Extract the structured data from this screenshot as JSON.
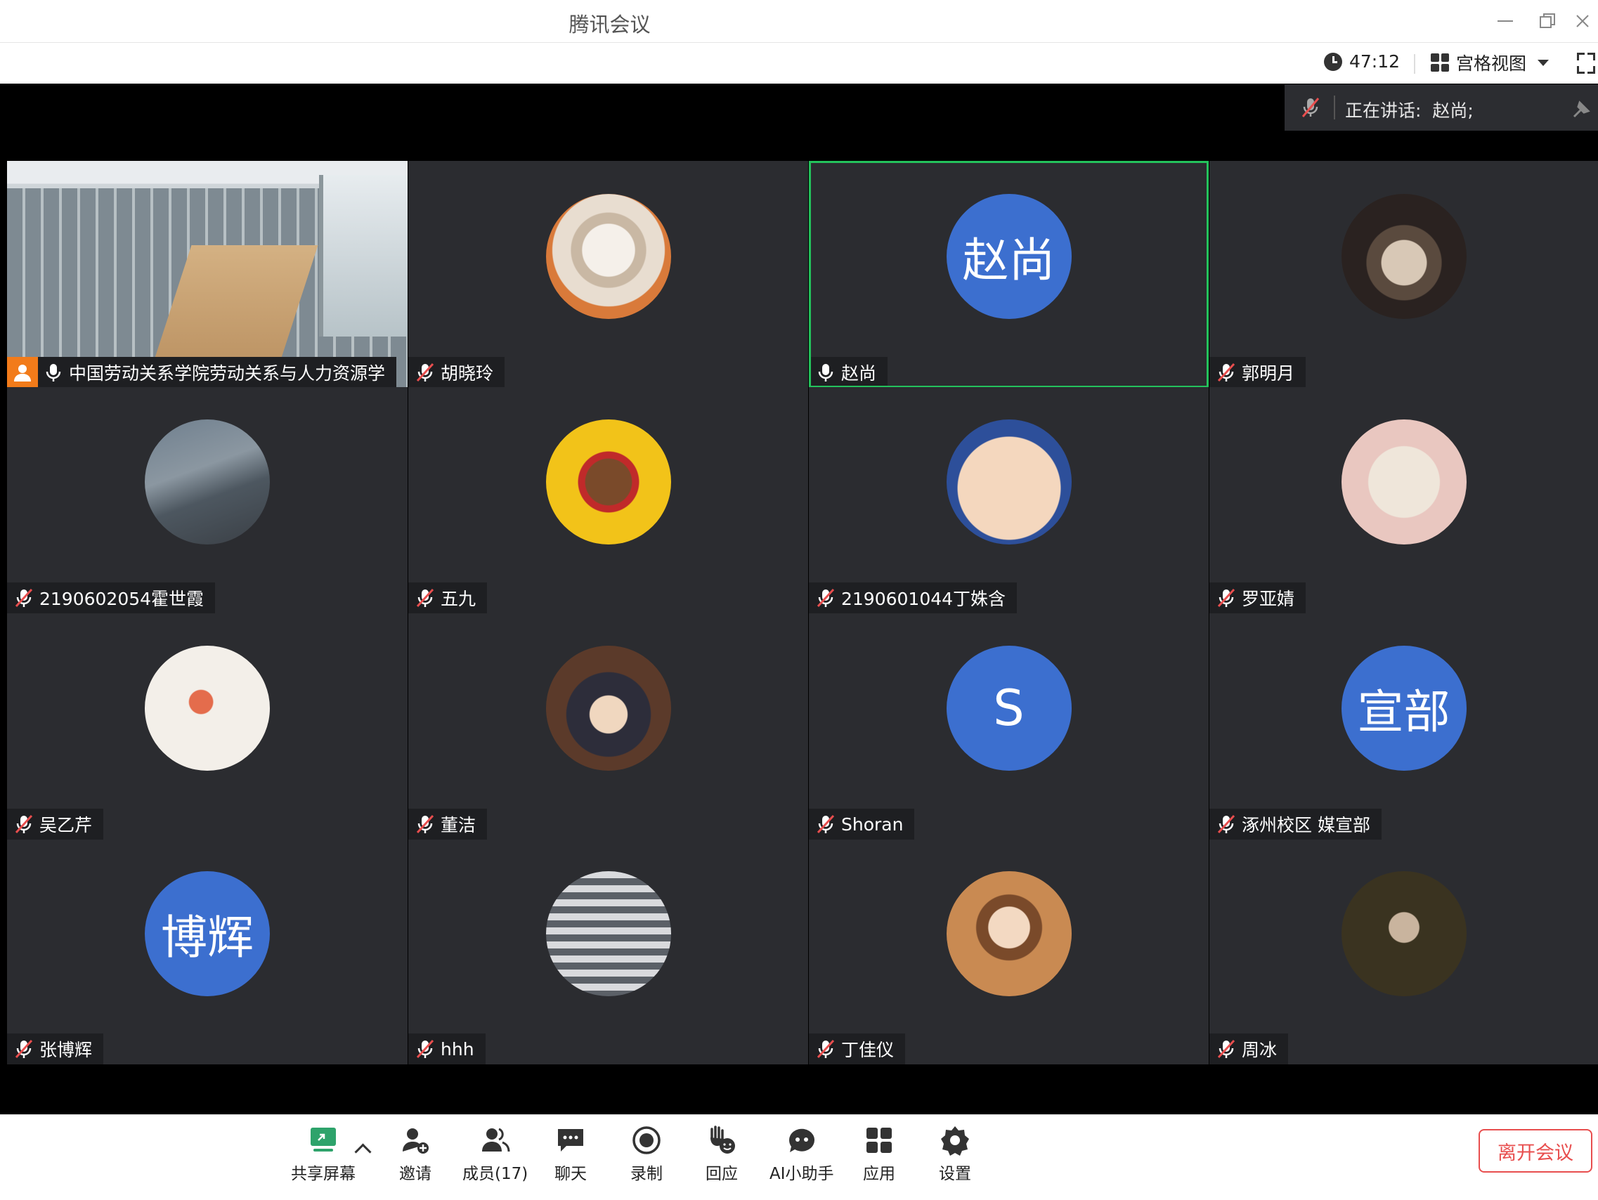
{
  "window": {
    "title": "腾讯会议"
  },
  "status": {
    "timer": "47:12",
    "view_mode": "宫格视图"
  },
  "speaking": {
    "label": "正在讲话:",
    "speakers": "赵尚;"
  },
  "participants": [
    {
      "name": "中国劳动关系学院劳动关系与人力资源学",
      "avatar_type": "video",
      "mic": "on",
      "host": true
    },
    {
      "name": "胡晓玲",
      "avatar_type": "photo-cat-astronaut",
      "mic": "muted"
    },
    {
      "name": "赵尚",
      "avatar_type": "text",
      "avatar_text": "赵尚",
      "mic": "on",
      "active_speaker": true
    },
    {
      "name": "郭明月",
      "avatar_type": "photo-hamster",
      "mic": "muted"
    },
    {
      "name": "2190602054霍世霞",
      "avatar_type": "photo-lake",
      "mic": "muted"
    },
    {
      "name": "五九",
      "avatar_type": "photo-cartoon-dreadlocks",
      "mic": "muted"
    },
    {
      "name": "2190601044丁姝含",
      "avatar_type": "photo-cartoon-face",
      "mic": "muted"
    },
    {
      "name": "罗亚婧",
      "avatar_type": "photo-window-girl",
      "mic": "muted"
    },
    {
      "name": "吴乙芹",
      "avatar_type": "photo-tea-cups",
      "mic": "muted"
    },
    {
      "name": "董洁",
      "avatar_type": "photo-child",
      "mic": "muted"
    },
    {
      "name": "Shoran",
      "avatar_type": "text",
      "avatar_text": "S",
      "mic": "muted"
    },
    {
      "name": "涿州校区 媒宣部",
      "avatar_type": "text",
      "avatar_text": "宣部",
      "mic": "muted"
    },
    {
      "name": "张博辉",
      "avatar_type": "text",
      "avatar_text": "博辉",
      "mic": "muted"
    },
    {
      "name": "hhh",
      "avatar_type": "photo-stairs",
      "mic": "muted"
    },
    {
      "name": "丁佳仪",
      "avatar_type": "photo-salute",
      "mic": "muted"
    },
    {
      "name": "周冰",
      "avatar_type": "photo-dark-portrait",
      "mic": "muted"
    }
  ],
  "toolbar": {
    "share": "共享屏幕",
    "invite": "邀请",
    "members": "成员(17)",
    "chat": "聊天",
    "record": "录制",
    "react": "回应",
    "ai": "AI小助手",
    "apps": "应用",
    "settings": "设置",
    "leave": "离开会议"
  },
  "colors": {
    "accent_blue": "#3c6fcf",
    "active_green": "#24c25c",
    "host_orange": "#f27b1a",
    "leave_red": "#e84e4e",
    "tile_bg": "#2b2c30"
  }
}
